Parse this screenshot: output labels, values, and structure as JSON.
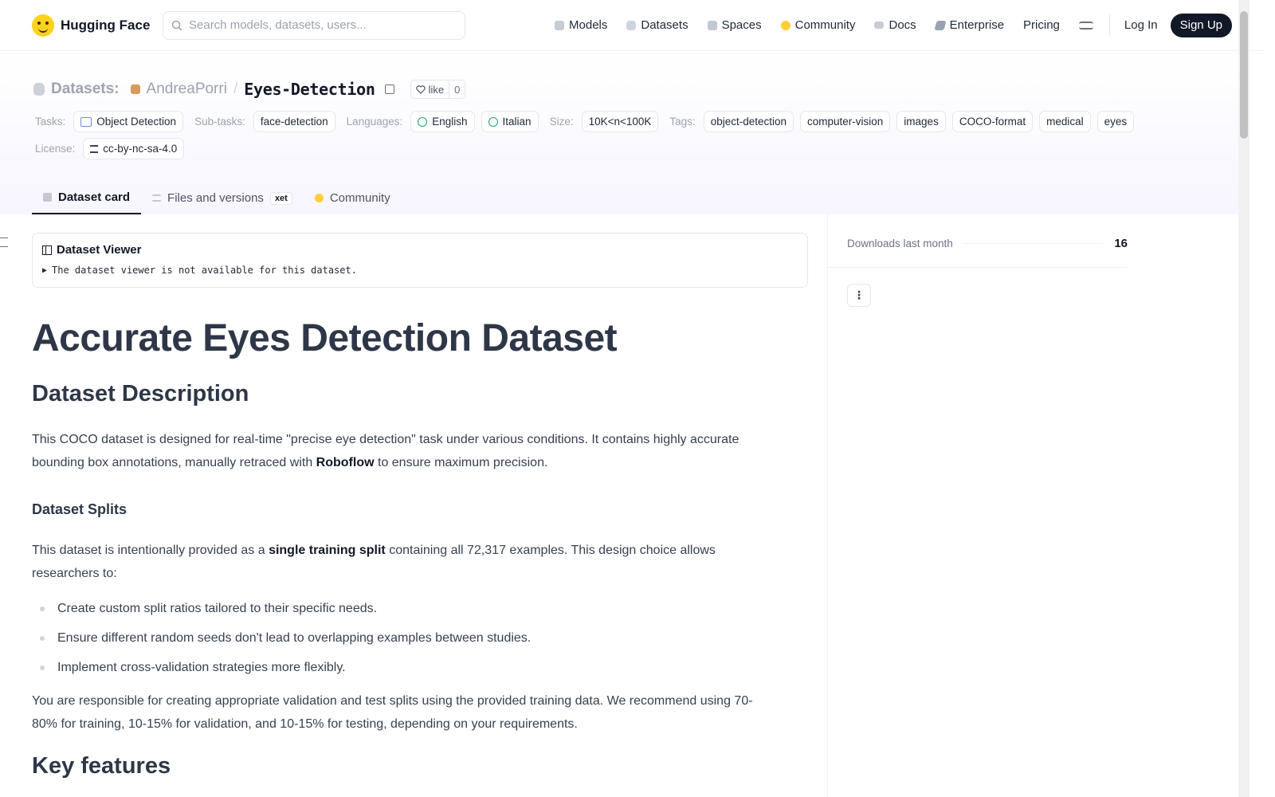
{
  "nav": {
    "brand": "Hugging Face",
    "search_placeholder": "Search models, datasets, users...",
    "links": [
      "Models",
      "Datasets",
      "Spaces",
      "Community",
      "Docs",
      "Enterprise",
      "Pricing"
    ],
    "login": "Log In",
    "signup": "Sign Up"
  },
  "header": {
    "crumb": "Datasets:",
    "owner": "AndreaPorri",
    "slash": "/",
    "name": "Eyes-Detection",
    "like_label": "like",
    "like_count": "0"
  },
  "tags": {
    "tasks_label": "Tasks:",
    "task": "Object Detection",
    "subtasks_label": "Sub-tasks:",
    "subtask": "face-detection",
    "languages_label": "Languages:",
    "languages": [
      "English",
      "Italian"
    ],
    "size_label": "Size:",
    "size": "10K<n<100K",
    "tags_label": "Tags:",
    "tags": [
      "object-detection",
      "computer-vision",
      "images",
      "COCO-format",
      "medical",
      "eyes"
    ],
    "license_label": "License:",
    "license": "cc-by-nc-sa-4.0"
  },
  "tabs": {
    "card": "Dataset card",
    "files": "Files and versions",
    "xet": "xet",
    "community": "Community"
  },
  "viewer": {
    "title": "Dataset Viewer",
    "note": "The dataset viewer is not available for this dataset."
  },
  "content": {
    "h1": "Accurate Eyes Detection Dataset",
    "h2_desc": "Dataset Description",
    "p1_a": "This COCO dataset is designed for real-time \"precise eye detection\" task under various conditions. It contains highly accurate bounding box annotations, manually retraced with ",
    "p1_b": "Roboflow",
    "p1_c": " to ensure maximum precision.",
    "h3_splits": "Dataset Splits",
    "p2_a": "This dataset is intentionally provided as a ",
    "p2_b": "single training split",
    "p2_c": " containing all 72,317 examples. This design choice allows researchers to:",
    "bullets": [
      "Create custom split ratios tailored to their specific needs.",
      "Ensure different random seeds don't lead to overlapping examples between studies.",
      "Implement cross-validation strategies more flexibly."
    ],
    "p3": "You are responsible for creating appropriate validation and test splits using the provided training data. We recommend using 70-80% for training, 10-15% for validation, and 10-15% for testing, depending on your requirements.",
    "h2_features": "Key features"
  },
  "sidebar": {
    "downloads_label": "Downloads last month",
    "downloads_value": "16",
    "more_label": "⋮"
  }
}
